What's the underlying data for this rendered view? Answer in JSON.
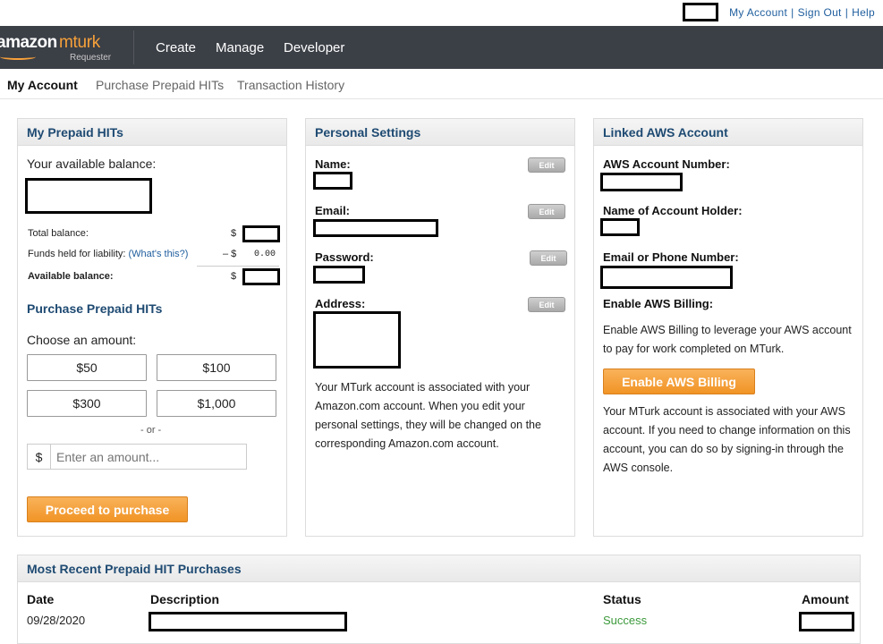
{
  "util": {
    "my_account": "My Account",
    "sign_out": "Sign Out",
    "help": "Help",
    "sep": "|"
  },
  "header": {
    "logo_word1": "amazon",
    "logo_word2": "mturk",
    "logo_sub": "Requester",
    "nav": [
      "Create",
      "Manage",
      "Developer"
    ]
  },
  "subnav": {
    "tabs": [
      "My Account",
      "Purchase Prepaid HITs",
      "Transaction History"
    ],
    "active": "My Account"
  },
  "prepaid": {
    "title": "My Prepaid HITs",
    "available_label": "Your available balance:",
    "total_label": "Total balance:",
    "funds_label": "Funds held for liability:",
    "whats_this": "(What's this?)",
    "available_row_label": "Available balance:",
    "dollar": "$",
    "funds_prefix": "– $",
    "funds_value": "0.00",
    "purchase_title": "Purchase Prepaid HITs",
    "choose_label": "Choose an amount:",
    "amounts": [
      "$50",
      "$100",
      "$300",
      "$1,000"
    ],
    "or_text": "- or -",
    "amount_placeholder": "Enter an amount...",
    "proceed_label": "Proceed to purchase"
  },
  "personal": {
    "title": "Personal Settings",
    "name_label": "Name:",
    "email_label": "Email:",
    "password_label": "Password:",
    "address_label": "Address:",
    "edit_label": "Edit",
    "note": "Your MTurk account is associated with your Amazon.com account. When you edit your personal settings, they will be changed on the corresponding Amazon.com account."
  },
  "aws": {
    "title": "Linked AWS Account",
    "acct_number_label": "AWS Account Number:",
    "holder_label": "Name of Account Holder:",
    "email_phone_label": "Email or Phone Number:",
    "enable_label": "Enable AWS Billing:",
    "enable_text": "Enable AWS Billing to leverage your AWS account to pay for work completed on MTurk.",
    "enable_button": "Enable AWS Billing",
    "note": "Your MTurk account is associated with your AWS account. If you need to change information on this account, you can do so by signing-in through the AWS console."
  },
  "recent": {
    "title": "Most Recent Prepaid HIT Purchases",
    "columns": [
      "Date",
      "Description",
      "Status",
      "Amount"
    ],
    "rows": [
      {
        "date": "09/28/2020",
        "status": "Success"
      }
    ]
  },
  "colors": {
    "header_bg": "#3b3f46",
    "accent_orange": "#f19425",
    "link_blue": "#1f5e9e",
    "success_green": "#3c9a3c"
  }
}
